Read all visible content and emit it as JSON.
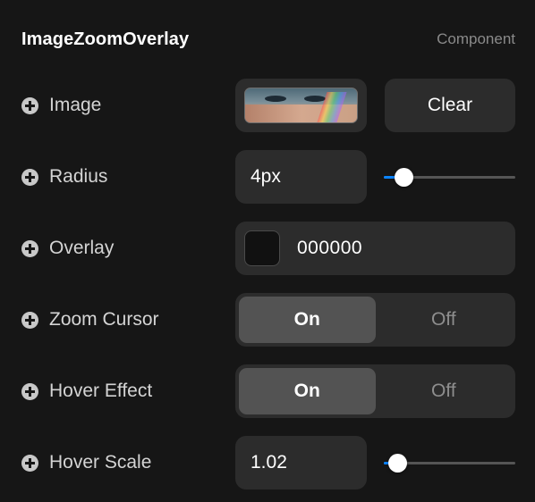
{
  "header": {
    "title": "ImageZoomOverlay",
    "subtitle": "Component"
  },
  "rows": {
    "image": {
      "label": "Image",
      "clear_label": "Clear",
      "thumb_icon": "portrait-thumbnail"
    },
    "radius": {
      "label": "Radius",
      "value": "4px",
      "slider_level": 0.15,
      "accent": "#0a84ff"
    },
    "overlay": {
      "label": "Overlay",
      "hex": "000000",
      "swatch_color": "#111111"
    },
    "zoom_cursor": {
      "label": "Zoom Cursor",
      "on": "On",
      "off": "Off",
      "selected": "On"
    },
    "hover_effect": {
      "label": "Hover Effect",
      "on": "On",
      "off": "Off",
      "selected": "On"
    },
    "hover_scale": {
      "label": "Hover Scale",
      "value": "1.02",
      "slider_level": 0.1,
      "accent": "#0a84ff"
    }
  }
}
